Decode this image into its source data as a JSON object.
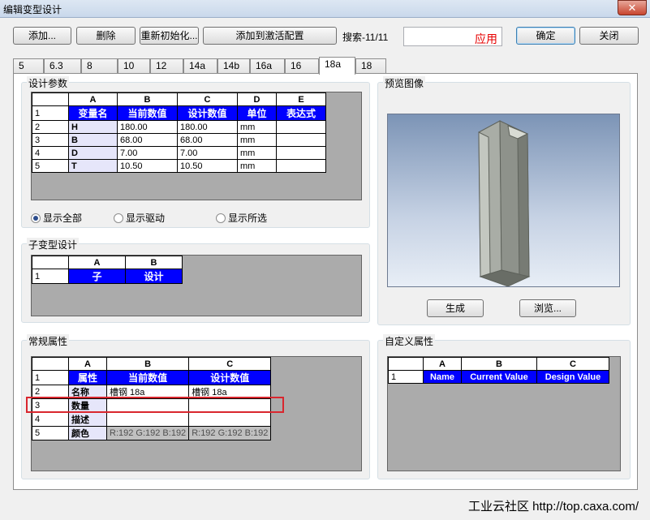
{
  "window": {
    "title": "编辑变型设计",
    "close_icon": "close-icon"
  },
  "toolbar": {
    "add_label": "添加...",
    "delete_label": "删除",
    "reinit_label": "重新初始化...",
    "add_active_label": "添加到激活配置",
    "search_label": "搜索-11/11",
    "apply_label": "应用",
    "ok_label": "确定",
    "close_label": "关闭"
  },
  "tabs": [
    "5",
    "6.3",
    "8",
    "10",
    "12",
    "14a",
    "14b",
    "16a",
    "16",
    "18a",
    "18"
  ],
  "active_tab": "18a",
  "design_params": {
    "legend": "设计参数",
    "col_letters": [
      "A",
      "B",
      "C",
      "D",
      "E"
    ],
    "headers": [
      "变量名",
      "当前数值",
      "设计数值",
      "单位",
      "表达式"
    ],
    "rows": [
      [
        "H",
        "180.00",
        "180.00",
        "mm",
        ""
      ],
      [
        "B",
        "68.00",
        "68.00",
        "mm",
        ""
      ],
      [
        "D",
        "7.00",
        "7.00",
        "mm",
        ""
      ],
      [
        "T",
        "10.50",
        "10.50",
        "mm",
        ""
      ]
    ],
    "radios": [
      "显示全部",
      "显示驱动",
      "显示所选"
    ],
    "selected_radio": "显示全部"
  },
  "sub_design": {
    "legend": "子变型设计",
    "col_letters": [
      "A",
      "B"
    ],
    "headers": [
      "子",
      "设计"
    ]
  },
  "preview": {
    "legend": "预览图像",
    "generate_label": "生成",
    "browse_label": "浏览..."
  },
  "general_props": {
    "legend": "常规属性",
    "col_letters": [
      "A",
      "B",
      "C"
    ],
    "headers": [
      "属性",
      "当前数值",
      "设计数值"
    ],
    "rows": [
      [
        "名称",
        "槽钢 18a",
        "槽钢 18a"
      ],
      [
        "数量",
        "",
        ""
      ],
      [
        "描述",
        "",
        ""
      ],
      [
        "颜色",
        "R:192 G:192 B:192",
        "R:192 G:192 B:192"
      ]
    ]
  },
  "custom_props": {
    "legend": "自定义属性",
    "col_letters": [
      "A",
      "B",
      "C"
    ],
    "headers": [
      "Name",
      "Current Value",
      "Design Value"
    ]
  },
  "footer": "工业云社区 http://top.caxa.com/",
  "colors": {
    "header_blue": "#0000ff",
    "highlight_red": "#d9262e",
    "apply_red": "#e60000"
  }
}
